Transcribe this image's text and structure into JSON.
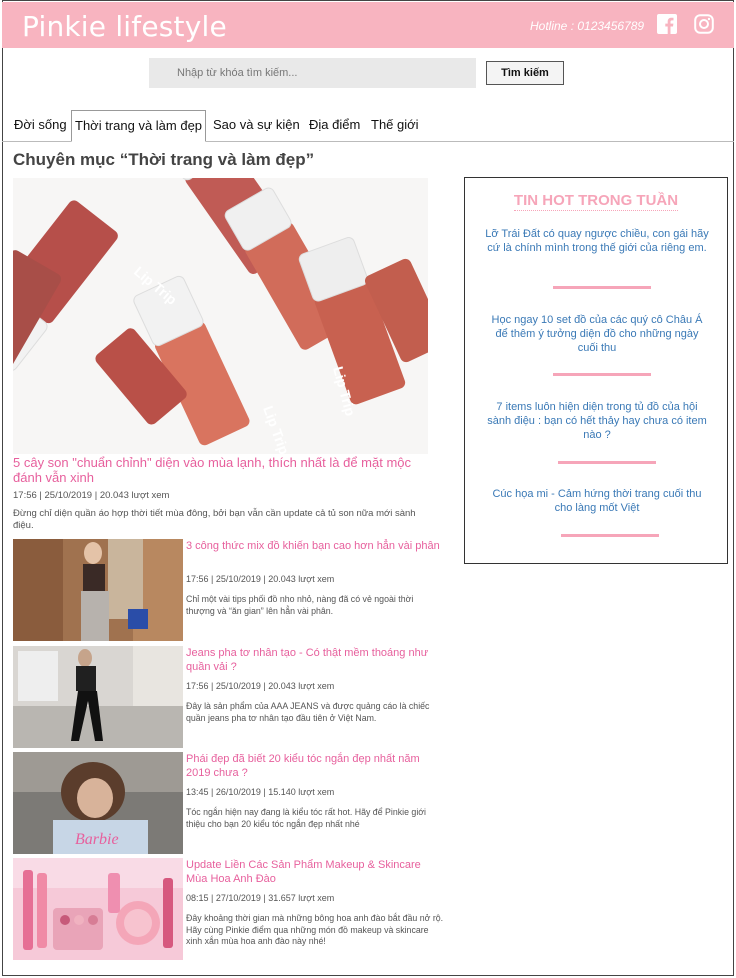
{
  "header": {
    "logo": "Pinkie lifestyle",
    "hotline": "Hotline : 0123456789",
    "icons": [
      "facebook-icon",
      "instagram-icon"
    ]
  },
  "search": {
    "placeholder": "Nhập từ khóa tìm kiếm...",
    "button_label": "Tìm kiếm"
  },
  "nav": {
    "tabs": [
      {
        "label": "Đời sống"
      },
      {
        "label": "Thời trang và làm đẹp"
      },
      {
        "label": "Sao và sự kiện"
      },
      {
        "label": "Địa điểm"
      },
      {
        "label": "Thế giới"
      }
    ],
    "active": "Thời trang và làm đẹp"
  },
  "main": {
    "title": "Chuyên mục “Thời trang và làm đẹp”",
    "hero": {
      "title": "5 cây son \"chuẩn chỉnh\" diện vào mùa lạnh, thích nhất là để mặt mộc đánh vẫn xinh",
      "meta": "17:56 | 25/10/2019 | 20.043 lượt xem",
      "desc": "Đừng chỉ diện quần áo hợp thời tiết mùa đông, bởi bạn vẫn cần update cả tủ son nữa mới sành điệu.",
      "image_text": "Lip Trip"
    },
    "articles": [
      {
        "title": "3 công thức mix đồ khiến bạn cao hơn hẳn vài phân",
        "meta": "17:56 | 25/10/2019 | 20.043 lượt xem",
        "desc": "Chỉ một vài tips phối đồ nho nhỏ, nàng đã có vẻ ngoài thời thượng và “ăn gian” lên hẳn vài phân."
      },
      {
        "title": "Jeans pha tơ nhân tạo - Có thật mềm thoáng như quần vải ?",
        "meta": "17:56 | 25/10/2019 | 20.043 lượt xem",
        "desc": "Đây là sản phẩm của AAA JEANS và được quảng cáo là chiếc quần jeans pha tơ nhân tạo đầu tiên ở Việt Nam."
      },
      {
        "title": "Phái đẹp đã biết 20 kiểu tóc ngắn đẹp nhất năm 2019 chưa ?",
        "meta": "13:45 | 26/10/2019 | 15.140 lượt xem",
        "desc": "Tóc ngắn hiện nay đang là kiểu tóc rất hot. Hãy để Pinkie giới thiệu cho bạn 20 kiểu tóc ngắn đẹp nhất nhé",
        "image_text": "Barbie"
      },
      {
        "title": "Update Liền Các Sản Phẩm Makeup & Skincare Mùa Hoa Anh Đào",
        "meta": "08:15 | 27/10/2019 | 31.657 lượt xem",
        "desc": "Đây khoảng thời gian mà những bông hoa anh đào bắt đầu nở rộ. Hãy cùng Pinkie điểm qua những món đồ makeup và skincare xinh xắn mùa hoa anh đào này nhé!"
      }
    ]
  },
  "sidebar": {
    "title": "TIN HOT TRONG TUẦN",
    "items": [
      {
        "text": "Lỡ Trái Đất có quay ngược chiều, con gái hãy cứ là chính mình trong thế giới của riêng em."
      },
      {
        "text": "Học ngay 10 set đồ của các quý cô Châu Á để thêm ý tưởng diện đồ cho những ngày cuối thu"
      },
      {
        "text": "7 items luôn hiện diện trong tủ đồ của hội sành điệu : bạn có hết thảy hay chưa có item nào ?"
      },
      {
        "text": "Cúc họa mi - Cảm hứng thời trang cuối thu cho làng mốt Việt"
      }
    ]
  },
  "colors": {
    "header_bg": "#f8b4c0",
    "accent_pink": "#e7609d",
    "sidebar_title": "#f6a5b9",
    "link_blue": "#3a79b6"
  }
}
